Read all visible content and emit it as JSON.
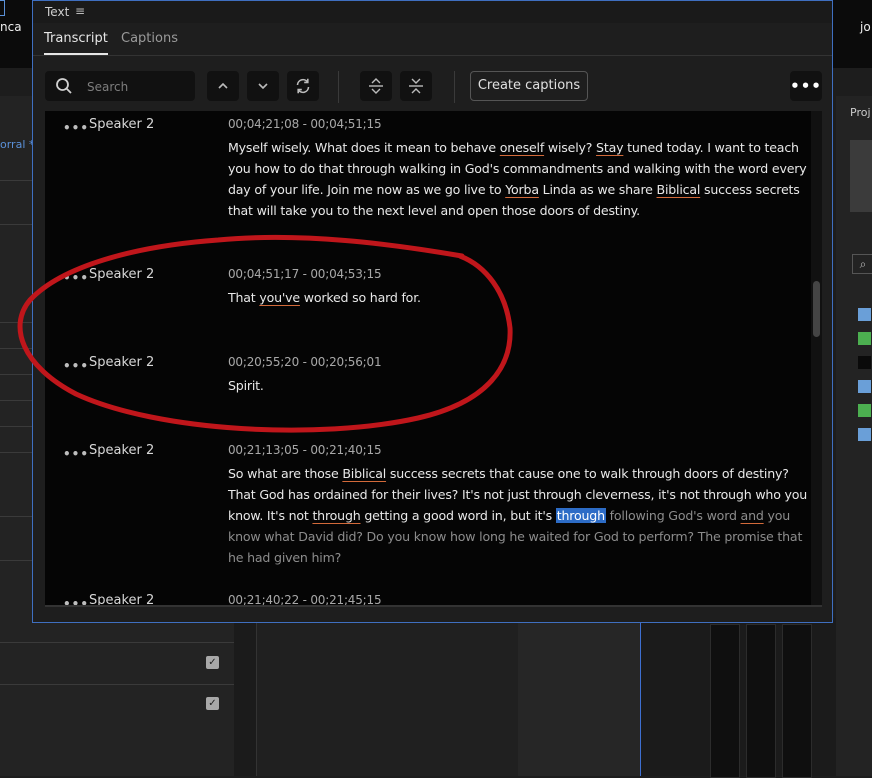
{
  "background": {
    "top_right_text": "jo",
    "top_left_text": "nca",
    "left_label": "orral * 1",
    "right_label": "Proj",
    "right_swatches": [
      "#6a9fd8",
      "#4caf50",
      "#0a0a0a",
      "#6a9fd8",
      "#4caf50",
      "#6a9fd8"
    ]
  },
  "panel": {
    "title": "Text",
    "tabs": [
      {
        "label": "Transcript",
        "active": true
      },
      {
        "label": "Captions",
        "active": false
      }
    ],
    "toolbar": {
      "search_placeholder": "Search",
      "create_captions_label": "Create captions"
    }
  },
  "transcript": {
    "segments": [
      {
        "speaker": "Speaker 2",
        "time": "00;04;21;08 - 00;04;51;15",
        "text_parts": [
          {
            "t": "Myself wisely. What does it mean to behave ",
            "s": ""
          },
          {
            "t": "oneself",
            "s": "u"
          },
          {
            "t": " wisely? ",
            "s": ""
          },
          {
            "t": "Stay",
            "s": "u"
          },
          {
            "t": " tuned today. I want to teach you how to do that through walking in God's commandments and walking with the word every day of your life. Join me now as we go live to ",
            "s": ""
          },
          {
            "t": "Yorba",
            "s": "u"
          },
          {
            "t": " Linda as we share ",
            "s": ""
          },
          {
            "t": "Biblical",
            "s": "u"
          },
          {
            "t": " success secrets that will take you to the next level and open those doors of destiny.",
            "s": ""
          }
        ]
      },
      {
        "speaker": "Speaker 2",
        "time": "00;04;51;17 - 00;04;53;15",
        "text_parts": [
          {
            "t": "That ",
            "s": ""
          },
          {
            "t": "you've",
            "s": "u"
          },
          {
            "t": " worked so hard for.",
            "s": ""
          }
        ]
      },
      {
        "speaker": "Speaker 2",
        "time": "00;20;55;20 - 00;20;56;01",
        "text_parts": [
          {
            "t": "Spirit.",
            "s": ""
          }
        ]
      },
      {
        "speaker": "Speaker 2",
        "time": "00;21;13;05 - 00;21;40;15",
        "text_parts": [
          {
            "t": "So what are those ",
            "s": ""
          },
          {
            "t": "Biblical",
            "s": "u"
          },
          {
            "t": " success secrets that cause one to walk through doors of destiny? That God has ordained for their lives? It's not just through cleverness, it's not through who you know. It's not ",
            "s": ""
          },
          {
            "t": "through",
            "s": "u"
          },
          {
            "t": " getting a good word in, but it's ",
            "s": ""
          },
          {
            "t": "through",
            "s": "hl"
          },
          {
            "t": " following God's word ",
            "s": "dim"
          },
          {
            "t": "and",
            "s": "dim u"
          },
          {
            "t": " you know what David did? Do you know how long he waited for God to perform? The promise that he had given him?",
            "s": "dim"
          }
        ]
      },
      {
        "speaker": "Speaker 2",
        "time": "00;21;40;22 - 00;21;45;15",
        "text_parts": []
      }
    ]
  }
}
